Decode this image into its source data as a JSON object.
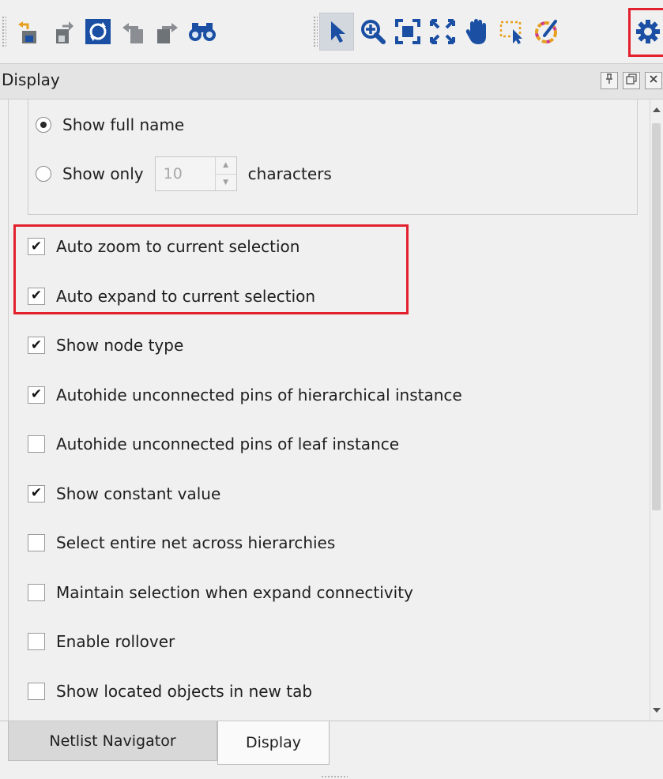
{
  "toolbar": {
    "buttons": [
      {
        "name": "import-icon"
      },
      {
        "name": "export-icon"
      },
      {
        "name": "refresh-icon"
      },
      {
        "name": "back-icon"
      },
      {
        "name": "forward-icon"
      },
      {
        "name": "find-binoculars-icon"
      },
      {
        "name": "select-pointer-icon",
        "active": true
      },
      {
        "name": "zoom-in-icon"
      },
      {
        "name": "fit-selection-icon"
      },
      {
        "name": "fit-window-icon"
      },
      {
        "name": "pan-hand-icon"
      },
      {
        "name": "marquee-select-icon"
      },
      {
        "name": "color-palette-icon"
      },
      {
        "name": "settings-gear-icon",
        "highlighted": true
      }
    ]
  },
  "dock": {
    "title": "Display",
    "pin_icon": "pin-icon",
    "float_icon": "float-icon",
    "close_icon": "close-icon"
  },
  "display": {
    "name_options": {
      "full_name": {
        "label": "Show full name",
        "selected": true
      },
      "only": {
        "label": "Show only",
        "selected": false,
        "value": "10",
        "suffix": "characters"
      }
    },
    "options": [
      {
        "label": "Auto zoom to current selection",
        "checked": true,
        "highlighted": true
      },
      {
        "label": "Auto expand to current selection",
        "checked": true,
        "highlighted": true
      },
      {
        "label": "Show node type",
        "checked": true
      },
      {
        "label": "Autohide unconnected pins of hierarchical instance",
        "checked": true
      },
      {
        "label": "Autohide unconnected pins of leaf instance",
        "checked": false
      },
      {
        "label": "Show constant value",
        "checked": true
      },
      {
        "label": "Select entire net across hierarchies",
        "checked": false
      },
      {
        "label": "Maintain selection when expand connectivity",
        "checked": false
      },
      {
        "label": "Enable rollover",
        "checked": false
      },
      {
        "label": "Show located objects in new tab",
        "checked": false
      }
    ]
  },
  "tabs": [
    {
      "label": "Netlist Navigator",
      "active": false
    },
    {
      "label": "Display",
      "active": true
    }
  ],
  "colors": {
    "highlight": "#e3202d",
    "icon_blue": "#1a4fa3",
    "icon_teal": "#1b7fa8"
  }
}
